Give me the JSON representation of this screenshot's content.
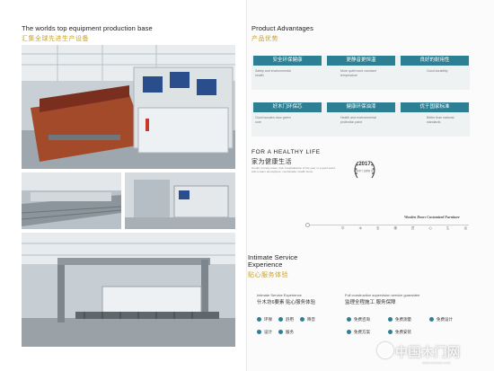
{
  "left_page": {
    "title_en": "The worlds top equipment production base",
    "title_cn": "汇集全球先进生产设备"
  },
  "right_page": {
    "advantages": {
      "title_en": "Product Advantages",
      "title_cn": "产品优势",
      "items": [
        {
          "heading": "安全环保健康",
          "desc": "Safety and environmental health"
        },
        {
          "heading": "更静音更恒温",
          "desc": "More quiet more constant temperature"
        },
        {
          "heading": "良好的耐用性",
          "desc": "Good durability"
        },
        {
          "heading": "好木门环保芯",
          "desc": "Good wooden door green core"
        },
        {
          "heading": "健康环保油漆",
          "desc": "Health and environmental protection paint"
        },
        {
          "heading": "优于国家标准",
          "desc": "Better than national standards"
        }
      ]
    },
    "healthy_life": {
      "title_en": "FOR A HEALTHY LIFE",
      "title_cn": "家为健康生活",
      "body": "Tender, homely areas, their hospitalization of the year, in a good world with a warm atmosphere, comfortable, health home."
    },
    "award": {
      "year": "2017",
      "caption": "中国木门 品牌日 金奖"
    },
    "timeline": {
      "brand": "Wooden Doors Customized Furniture",
      "labels": [
        "华",
        "木",
        "至",
        "臻",
        "匠",
        "心",
        "生",
        "活"
      ]
    },
    "service": {
      "title_en": "Intimate Service Experience",
      "title_cn": "贴心服务体验",
      "left": {
        "heading_en": "Intimate Service Experience",
        "heading_cn": "什木坊6要素 贴心服务体验",
        "items": [
          "环保",
          "舒用",
          "降音",
          "设计",
          "服务"
        ]
      },
      "right": {
        "heading_en": "Full construction supervision service guarantee",
        "heading_cn": "监理全程施工 服务保障",
        "items": [
          "免费咨询",
          "免费测量",
          "免费设计",
          "免费方案",
          "免费安装"
        ]
      }
    },
    "watermark": {
      "text": "中国木门网",
      "url": "www.mumen.com"
    }
  },
  "colors": {
    "accent": "#2d7f94",
    "gold": "#c9a227"
  }
}
